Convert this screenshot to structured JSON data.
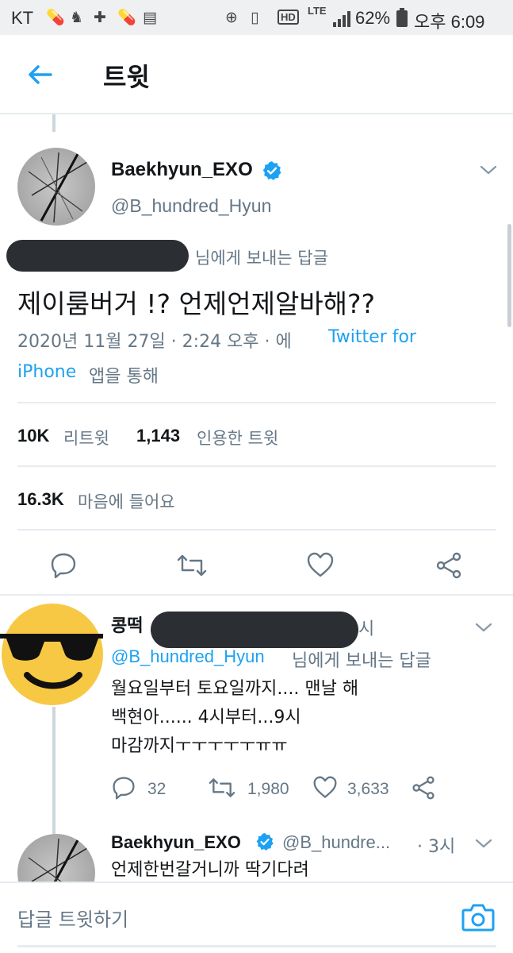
{
  "status_bar": {
    "carrier": "KT",
    "lte": "LTE",
    "battery": "62%",
    "time": "오후 6:09"
  },
  "app_bar": {
    "title": "트윗"
  },
  "main_tweet": {
    "display_name": "Baekhyun_EXO",
    "handle": "@B_hundred_Hyun",
    "reply_to_suffix": "님에게 보내는 답글",
    "text": "제이룸버거 !? 언제언제알바해??",
    "meta_date": "2020년 11월 27일 · 2:24 오후 · 에",
    "meta_source_1": "Twitter for",
    "meta_source_2": "iPhone",
    "meta_via": "앱을 통해",
    "retweets_count": "10K",
    "retweets_label": "리트윗",
    "quotes_count": "1,143",
    "quotes_label": "인용한 트윗",
    "likes_count": "16.3K",
    "likes_label": "마음에 들어요"
  },
  "reply": {
    "display_name": "콩떡",
    "time_suffix": "시",
    "reply_to_handle": "@B_hundred_Hyun",
    "reply_to_suffix": "님에게 보내는 답글",
    "line1": "월요일부터 토요일까지.... 맨날 해",
    "line2": "백현아...... 4시부터...9시",
    "line3": "마감까지ㅜㅜㅜㅜㅜㅠㅠ",
    "reply_count": "32",
    "retweet_count": "1,980",
    "like_count": "3,633"
  },
  "next_tweet": {
    "display_name": "Baekhyun_EXO",
    "handle": "@B_hundre...",
    "time": "· 3시",
    "text": "언제한번갈거니까 딱기다려"
  },
  "compose": {
    "placeholder": "답글 트윗하기"
  },
  "colors": {
    "accent": "#1da1f2",
    "muted": "#657786",
    "divider": "#e6ecf0"
  }
}
